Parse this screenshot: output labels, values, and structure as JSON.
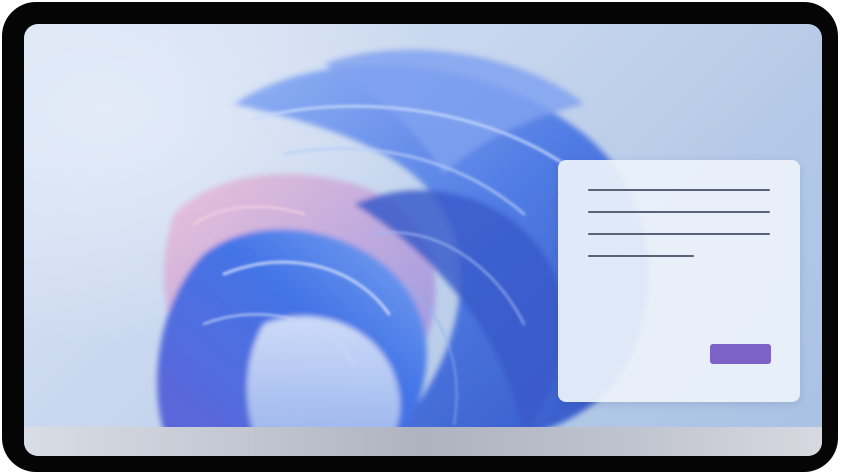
{
  "wallpaper": {
    "icon": "windows-bloom-wallpaper",
    "colors": {
      "background": "#c7d6ee",
      "bloom_primary": "#3f6fe0",
      "bloom_secondary": "#6b5fd8",
      "bloom_accent": "#e48fb4"
    }
  },
  "dialog": {
    "text_lines": 4,
    "button_color": "#7d63c8"
  }
}
